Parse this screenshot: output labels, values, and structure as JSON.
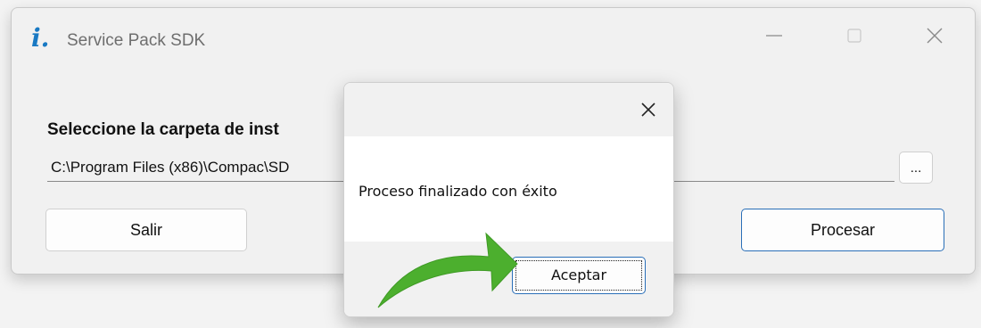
{
  "window": {
    "title": "Service Pack SDK",
    "icon": "info-i-icon",
    "icon_glyph": "i",
    "icon_dot": ".",
    "accent": "#1979c3",
    "controls": {
      "minimize": "minimize-icon",
      "maximize": "maximize-icon",
      "close": "close-icon"
    }
  },
  "main": {
    "label": "Seleccione la carpeta de inst",
    "path_value": "C:\\Program Files (x86)\\Compac\\SD",
    "browse_label": "...",
    "salir_label": "Salir",
    "procesar_label": "Procesar"
  },
  "dialog": {
    "message": "Proceso finalizado con éxito",
    "accept_label": "Aceptar",
    "close_icon": "close-icon"
  },
  "annotation": {
    "arrow_color": "#4caf2e",
    "icon": "green-arrow-icon"
  }
}
